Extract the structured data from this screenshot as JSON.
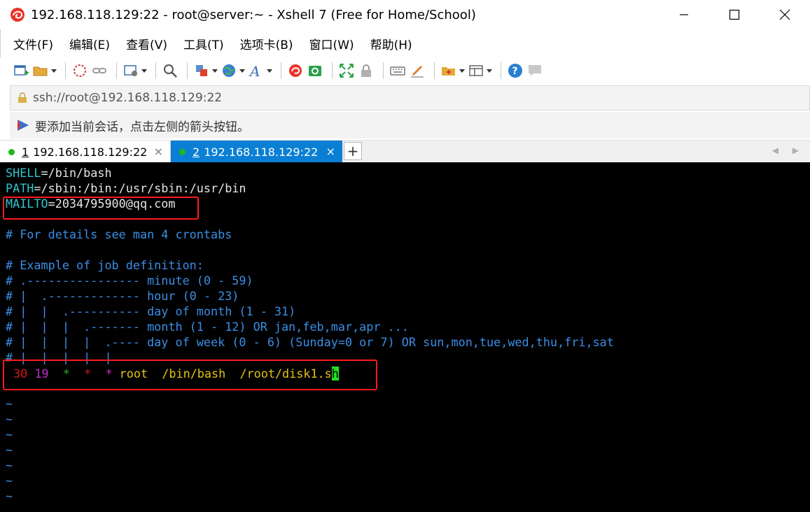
{
  "window": {
    "title": "192.168.118.129:22 - root@server:~ - Xshell 7 (Free for Home/School)"
  },
  "menu": [
    "文件(F)",
    "编辑(E)",
    "查看(V)",
    "工具(T)",
    "选项卡(B)",
    "窗口(W)",
    "帮助(H)"
  ],
  "address": {
    "value": "ssh://root@192.168.118.129:22"
  },
  "hint": {
    "text": "要添加当前会话，点击左侧的箭头按钮。"
  },
  "tabs": [
    {
      "num": "1",
      "label": "192.168.118.129:22",
      "close": "×"
    },
    {
      "num": "2",
      "label": "192.168.118.129:22",
      "close": "×"
    }
  ],
  "tab_add": "+",
  "tab_nav": "◀ ▶",
  "terminal": {
    "shell_key": "SHELL",
    "shell_val": "=/bin/bash",
    "path_key": "PATH",
    "path_val": "=/sbin:/bin:/usr/sbin:/usr/bin",
    "mailto_key": "MAILTO",
    "mailto_val": "=2034795900@qq.com",
    "comment1": "# For details see man 4 crontabs",
    "comment2": "# Example of job definition:",
    "def1": "# .---------------- minute (0 - 59)",
    "def2": "# |  .------------- hour (0 - 23)",
    "def3": "# |  |  .---------- day of month (1 - 31)",
    "def4": "# |  |  |  .------- month (1 - 12) OR jan,feb,mar,apr ...",
    "def5": "# |  |  |  |  .---- day of week (0 - 6) (Sunday=0 or 7) OR sun,mon,tue,wed,thu,fri,sat",
    "def6": "# |  |  |  |  |",
    "cron": {
      "minute": "30",
      "hour": "19",
      "dom": "*",
      "month": "*",
      "dow": "*",
      "user": "root",
      "shell": "/bin/bash",
      "script_prefix": "/root/disk1.s",
      "cursor_char": "h"
    },
    "tilde": "~"
  },
  "colors": {
    "tab_active": "#0a7fd4",
    "terminal_bg": "#000000",
    "highlight_box": "#ff1a1a",
    "cursor": "#20e020"
  }
}
